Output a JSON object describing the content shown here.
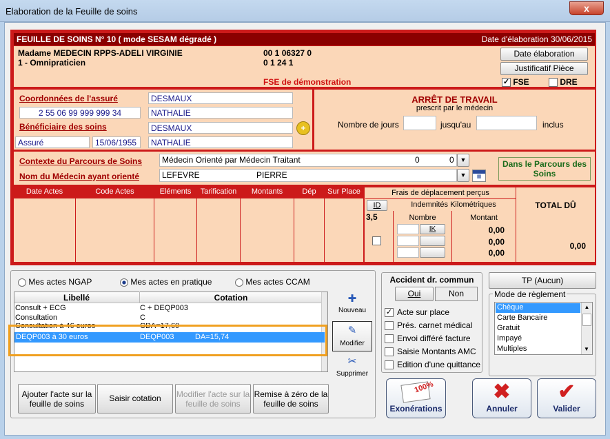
{
  "window": {
    "title": "Elaboration de la Feuille de soins",
    "close": "x"
  },
  "header": {
    "title": "FEUILLE DE SOINS  N° 10 ( mode SESAM dégradé )",
    "date": "Date d'élaboration 30/06/2015"
  },
  "doctor": {
    "name": "Madame MEDECIN RPPS-ADELI VIRGINIE",
    "specialty": "1 - Omnipraticien",
    "id1": "00 1 06327 0",
    "id2": "0 1 24 1",
    "demo": "FSE de démonstration"
  },
  "buttons": {
    "date_elab": "Date élaboration",
    "justificatif": "Justificatif Pièce",
    "fse": "FSE",
    "dre": "DRE"
  },
  "assure": {
    "label": "Coordonnées de l'assuré",
    "nir": "2 55 06 99 999 999 34",
    "nom": "DESMAUX",
    "prenom": "NATHALIE"
  },
  "beneficiaire": {
    "label": "Bénéficiaire des soins",
    "qualite": "Assuré",
    "naissance": "15/06/1955",
    "nom": "DESMAUX",
    "prenom": "NATHALIE"
  },
  "arret": {
    "title": "ARRÊT DE TRAVAIL",
    "subtitle": "prescrit par le médecin",
    "nb_jours": "Nombre de jours",
    "jusquau": "jusqu'au",
    "inclus": "inclus"
  },
  "parcours": {
    "label": "Contexte du Parcours de Soins",
    "value": "Médecin Orienté par Médecin Traitant",
    "v1": "0",
    "v2": "0",
    "medecin_label": "Nom du Médecin ayant orienté",
    "med_nom": "LEFEVRE",
    "med_prenom": "PIERRE",
    "status": "Dans le Parcours des Soins"
  },
  "table": {
    "columns": [
      "Date Actes",
      "Code Actes",
      "Eléments",
      "Tarification",
      "Montants",
      "Dép",
      "Sur Place"
    ],
    "frais": "Frais de déplacement perçus",
    "id": "ID",
    "indemnites": "Indemnités Kilométriques",
    "val": "3,5",
    "nombre": "Nombre",
    "montant": "Montant",
    "ik": "IK",
    "amounts": [
      "0,00",
      "0,00",
      "0,00"
    ],
    "total_label": "TOTAL DÛ",
    "total": "0,00"
  },
  "tabs": {
    "ngap": "Mes actes NGAP",
    "pratique": "Mes actes en pratique",
    "ccam": "Mes actes CCAM"
  },
  "acts": {
    "h_libelle": "Libellé",
    "h_cotation": "Cotation",
    "rows": [
      {
        "libelle": "Consult + ECG",
        "cotation": "C + DEQP003",
        "da": ""
      },
      {
        "libelle": "Consultation",
        "cotation": "C",
        "da": ""
      },
      {
        "libelle": "Consultation à 46 euros",
        "cotation": "CDA=17,60",
        "da": ""
      },
      {
        "libelle": "DEQP003 à 30 euros",
        "cotation": "DEQP003",
        "da": "DA=15,74"
      }
    ]
  },
  "side": {
    "nouveau": "Nouveau",
    "modifier": "Modifier",
    "supprimer": "Supprimer"
  },
  "bottom": {
    "ajouter": "Ajouter l'acte sur la feuille de soins",
    "saisir": "Saisir cotation",
    "modifier": "Modifier l'acte sur la feuille de soins",
    "remise": "Remise à zéro de la feuille de soins"
  },
  "accident": {
    "title": "Accident dr. commun",
    "oui": "Oui",
    "non": "Non"
  },
  "options": [
    {
      "label": "Acte sur place",
      "checked": true
    },
    {
      "label": "Prés. carnet médical",
      "checked": false
    },
    {
      "label": "Envoi différé facture",
      "checked": false
    },
    {
      "label": "Saisie Montants AMC",
      "checked": false
    },
    {
      "label": "Edition d'une quittance",
      "checked": false
    }
  ],
  "tp": "TP (Aucun)",
  "reglement": {
    "title": "Mode de règlement",
    "items": [
      "Chèque",
      "Carte Bancaire",
      "Gratuit",
      "Impayé",
      "Multiples"
    ],
    "selected": "Chèque"
  },
  "actions": {
    "exonerations": "Exonérations",
    "stamp": "100%",
    "annuler": "Annuler",
    "valider": "Valider"
  },
  "colors": {
    "red": "#cc1a1a",
    "dark": "#8a0000",
    "peach": "#fbd7b8",
    "highlight": "#3399ff",
    "orange": "#f0a020"
  }
}
